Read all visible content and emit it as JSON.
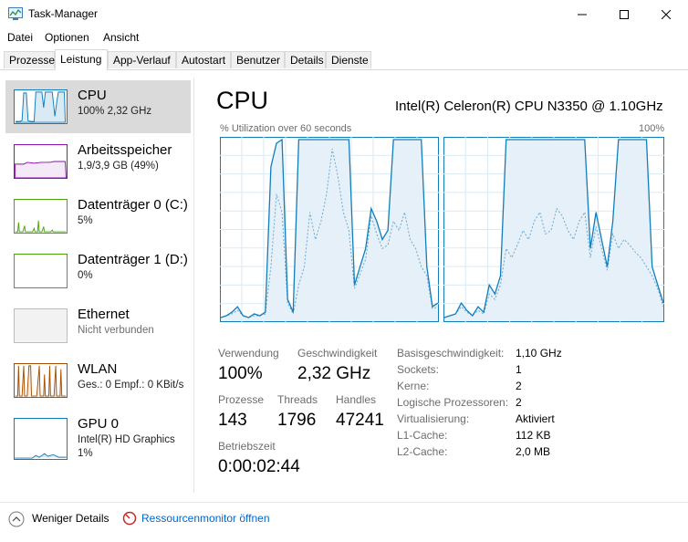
{
  "window": {
    "title": "Task-Manager",
    "minimize_symbol": "—",
    "maximize_symbol": "☐",
    "close_symbol": "✕"
  },
  "menu": [
    "Datei",
    "Optionen",
    "Ansicht"
  ],
  "tabs": [
    "Prozesse",
    "Leistung",
    "App-Verlauf",
    "Autostart",
    "Benutzer",
    "Details",
    "Dienste"
  ],
  "active_tab": "Leistung",
  "sidebar": [
    {
      "title": "CPU",
      "sub": "100%  2,32 GHz",
      "color": "#117dbb"
    },
    {
      "title": "Arbeitsspeicher",
      "sub": "1,9/3,9 GB (49%)",
      "color": "#8b12ae"
    },
    {
      "title": "Datenträger 0 (C:)",
      "sub": "5%",
      "color": "#4da60c"
    },
    {
      "title": "Datenträger 1 (D:)",
      "sub": "0%",
      "color": "#4da60c"
    },
    {
      "title": "Ethernet",
      "sub": "Nicht verbunden",
      "color": "#a0a0a0"
    },
    {
      "title": "WLAN",
      "sub": "Ges.: 0  Empf.: 0 KBit/s",
      "color": "#a74f01"
    },
    {
      "title": "GPU 0",
      "sub": "Intel(R) HD Graphics",
      "sub2": "1%",
      "color": "#117dbb"
    }
  ],
  "main": {
    "title": "CPU",
    "cpu_name": "Intel(R) Celeron(R) CPU N3350 @ 1.10GHz",
    "util_label": "% Utilization over 60 seconds",
    "util_max": "100%",
    "stats": {
      "verwendung_label": "Verwendung",
      "verwendung": "100%",
      "geschwindigkeit_label": "Geschwindigkeit",
      "geschwindigkeit": "2,32 GHz",
      "prozesse_label": "Prozesse",
      "prozesse": "143",
      "threads_label": "Threads",
      "threads": "1796",
      "handles_label": "Handles",
      "handles": "47241",
      "betriebszeit_label": "Betriebszeit",
      "betriebszeit": "0:00:02:44"
    },
    "details": [
      {
        "label": "Basisgeschwindigkeit:",
        "value": "1,10 GHz"
      },
      {
        "label": "Sockets:",
        "value": "1"
      },
      {
        "label": "Kerne:",
        "value": "2"
      },
      {
        "label": "Logische Prozessoren:",
        "value": "2"
      },
      {
        "label": "Virtualisierung:",
        "value": "Aktiviert"
      },
      {
        "label": "L1-Cache:",
        "value": "112 KB"
      },
      {
        "label": "L2-Cache:",
        "value": "2,0 MB"
      }
    ]
  },
  "footer": {
    "fewer_details": "Weniger Details",
    "resource_monitor": "Ressourcenmonitor öffnen"
  },
  "graph_series": {
    "core0": [
      2,
      3,
      5,
      8,
      3,
      2,
      4,
      3,
      5,
      85,
      98,
      100,
      12,
      5,
      100,
      100,
      100,
      100,
      100,
      100,
      100,
      100,
      100,
      100,
      20,
      30,
      40,
      62,
      55,
      45,
      50,
      100,
      100,
      100,
      100,
      100,
      100,
      30,
      8,
      10
    ],
    "core0_dash": [
      2,
      3,
      4,
      6,
      3,
      2,
      3,
      3,
      4,
      30,
      70,
      60,
      10,
      4,
      20,
      30,
      60,
      45,
      55,
      70,
      95,
      80,
      60,
      50,
      18,
      26,
      34,
      58,
      48,
      40,
      42,
      55,
      50,
      60,
      45,
      40,
      30,
      25,
      7,
      8
    ],
    "core1": [
      2,
      3,
      4,
      10,
      6,
      3,
      8,
      5,
      20,
      15,
      25,
      100,
      100,
      100,
      100,
      100,
      100,
      100,
      100,
      100,
      100,
      100,
      100,
      100,
      100,
      100,
      40,
      60,
      45,
      30,
      55,
      100,
      100,
      100,
      100,
      100,
      100,
      30,
      20,
      10
    ],
    "core1_dash": [
      2,
      3,
      4,
      8,
      5,
      3,
      6,
      4,
      15,
      12,
      20,
      40,
      35,
      42,
      50,
      45,
      55,
      60,
      48,
      50,
      62,
      58,
      50,
      45,
      55,
      60,
      35,
      52,
      40,
      28,
      48,
      40,
      45,
      42,
      38,
      35,
      30,
      25,
      18,
      8
    ]
  }
}
